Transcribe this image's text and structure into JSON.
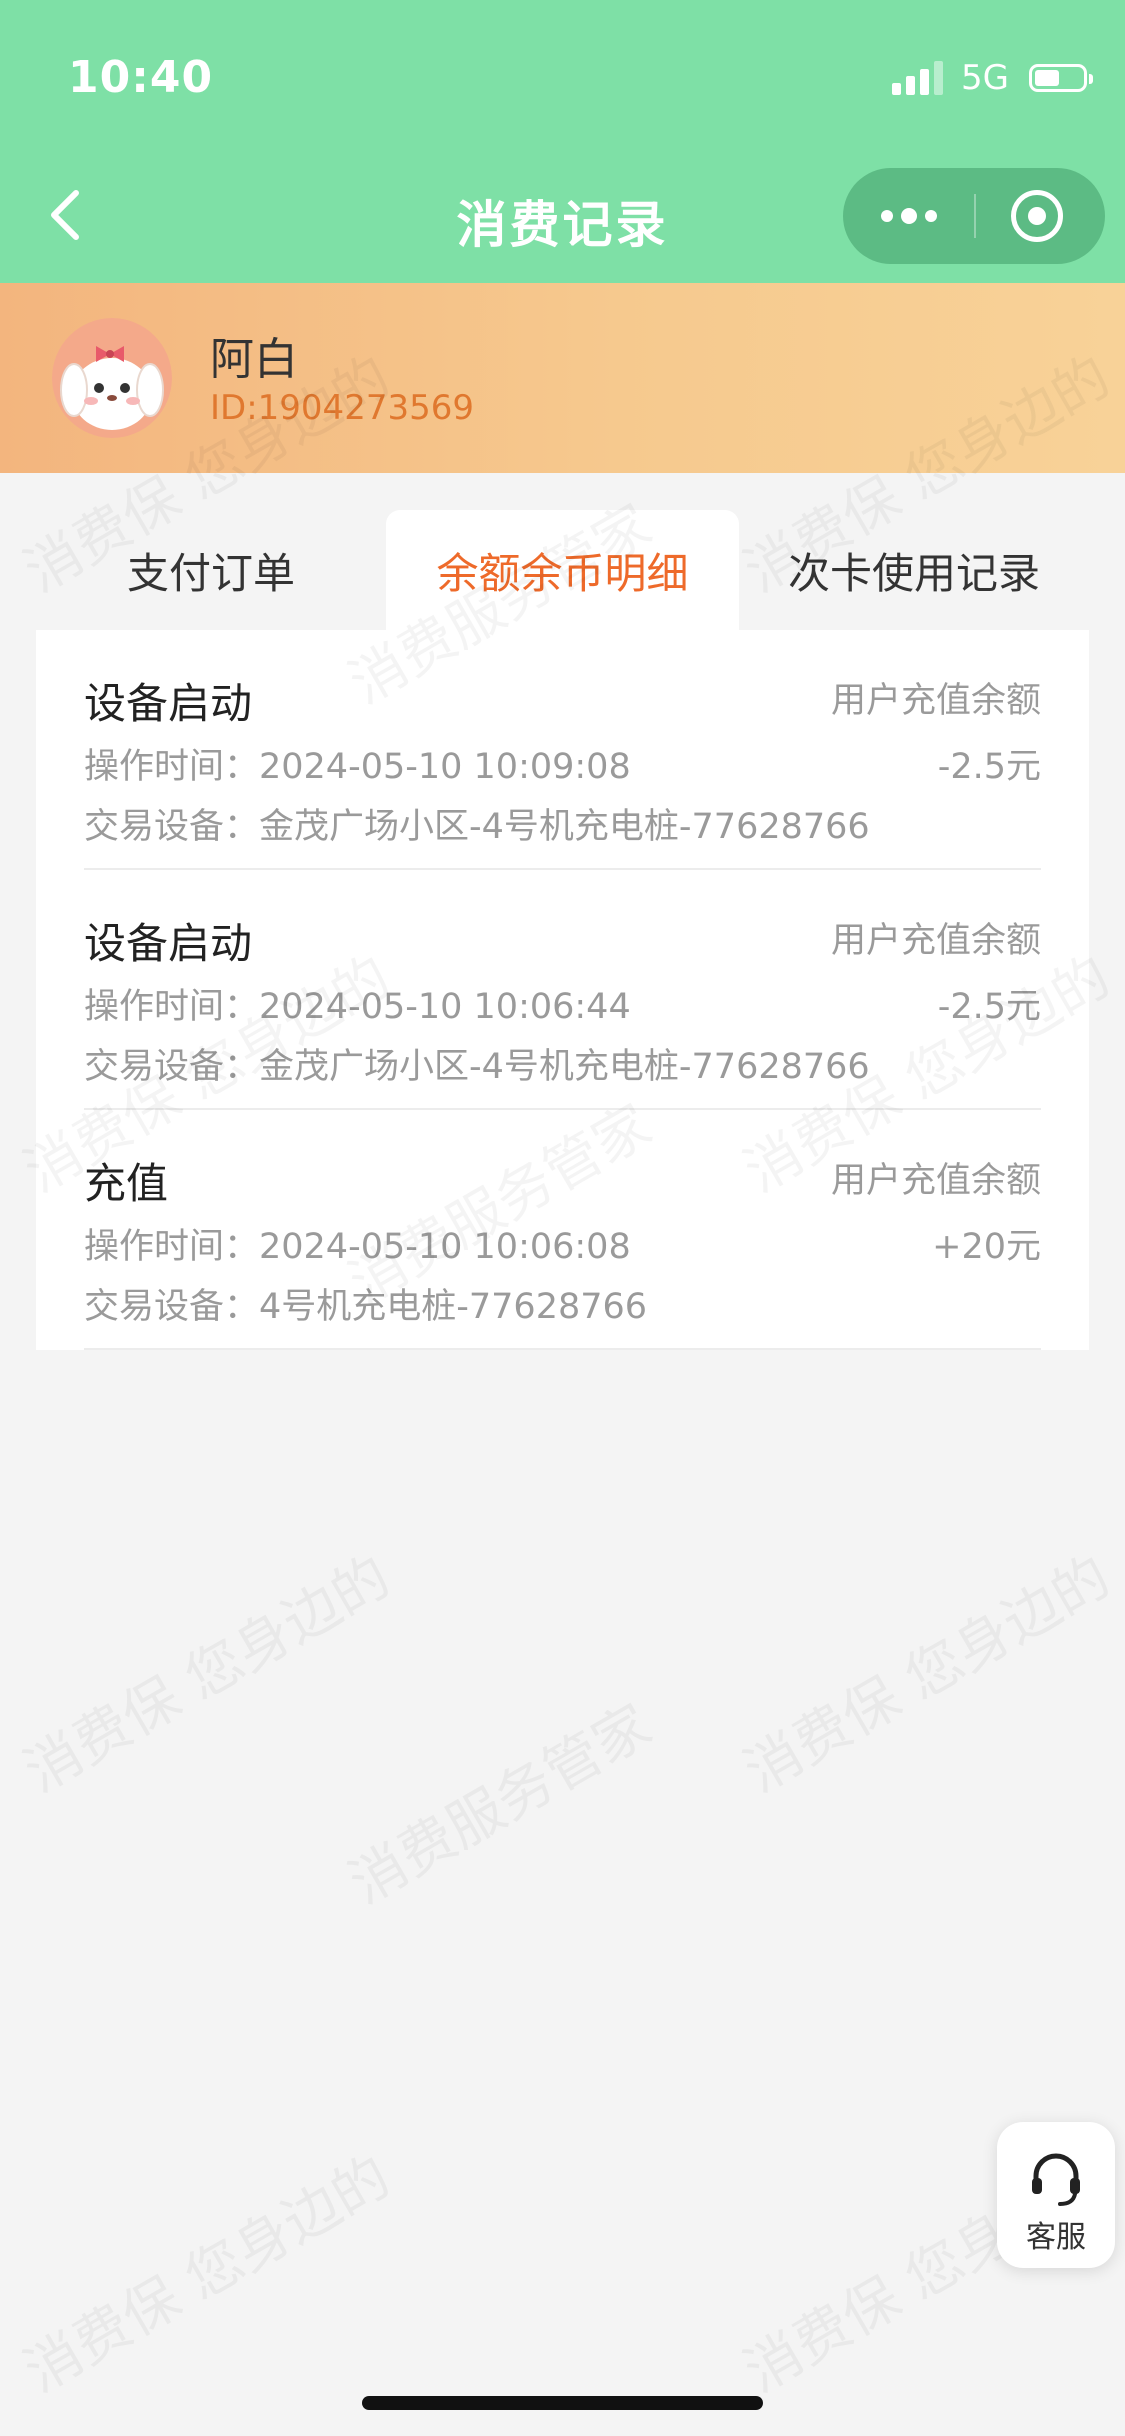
{
  "status_bar": {
    "time": "10:40",
    "network": "5G"
  },
  "nav": {
    "title": "消费记录"
  },
  "user": {
    "name": "阿白",
    "id": "ID:1904273569"
  },
  "tabs": [
    {
      "label": "支付订单",
      "active": false
    },
    {
      "label": "余额余币明细",
      "active": true
    },
    {
      "label": "次卡使用记录",
      "active": false
    }
  ],
  "records": [
    {
      "title": "设备启动",
      "type": "用户充值余额",
      "time": "操作时间：2024-05-10 10:09:08",
      "amount": "-2.5元",
      "device": "交易设备：金茂广场小区-4号机充电桩-77628766"
    },
    {
      "title": "设备启动",
      "type": "用户充值余额",
      "time": "操作时间：2024-05-10 10:06:44",
      "amount": "-2.5元",
      "device": "交易设备：金茂广场小区-4号机充电桩-77628766"
    },
    {
      "title": "充值",
      "type": "用户充值余额",
      "time": "操作时间：2024-05-10 10:06:08",
      "amount": "+20元",
      "device": "交易设备：4号机充电桩-77628766"
    }
  ],
  "watermark": {
    "a": "消费保 您身边的",
    "b": "消费服务管家"
  },
  "service": {
    "label": "客服"
  },
  "colors": {
    "header": "#7ee0a6",
    "accent": "#ee6a2a",
    "id_text": "#e0782f"
  }
}
